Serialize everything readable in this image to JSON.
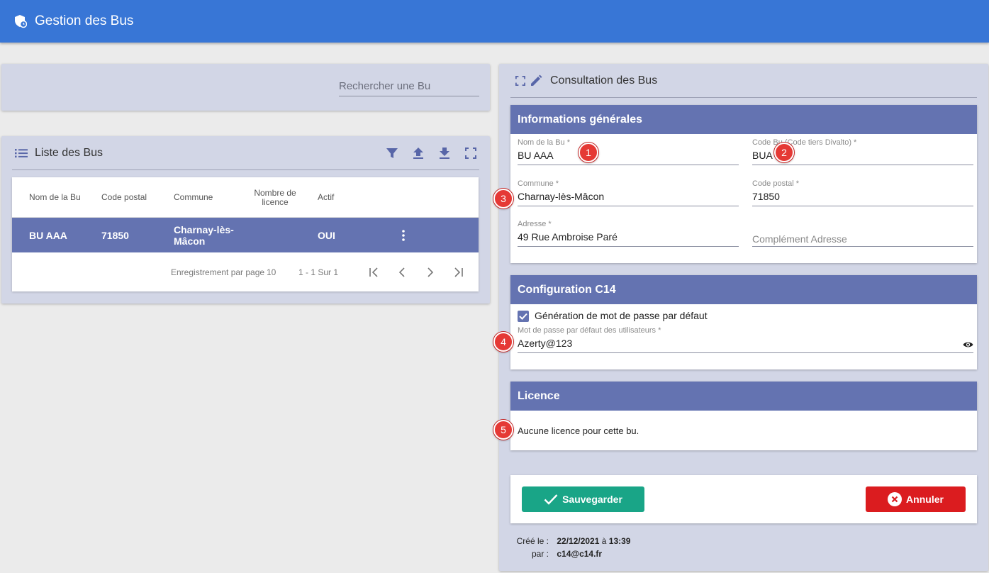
{
  "app": {
    "title": "Gestion des Bus"
  },
  "search": {
    "placeholder": "Rechercher une Bu"
  },
  "list": {
    "title": "Liste des Bus",
    "columns": [
      "Nom de la Bu",
      "Code postal",
      "Commune",
      "Nombre de licence",
      "Actif"
    ],
    "rows": [
      {
        "nom": "BU AAA",
        "code_postal": "71850",
        "commune": "Charnay-lès-Mâcon",
        "nombre_licence": "",
        "actif": "OUI"
      }
    ],
    "footer": {
      "per_page_label": "Enregistrement par page",
      "per_page_value": "10",
      "range": "1 - 1 Sur 1"
    }
  },
  "detail": {
    "title": "Consultation des Bus",
    "general": {
      "title": "Informations générales",
      "nom_label": "Nom de la Bu *",
      "nom_value": "BU AAA",
      "code_label": "Code Bu (Code tiers Divalto) *",
      "code_value": "BUA",
      "commune_label": "Commune *",
      "commune_value": "Charnay-lès-Mâcon",
      "cp_label": "Code postal *",
      "cp_value": "71850",
      "adresse_label": "Adresse *",
      "adresse_value": "49 Rue Ambroise Paré",
      "complement_placeholder": "Complément Adresse"
    },
    "config": {
      "title": "Configuration C14",
      "checkbox_label": "Génération de mot de passe par défaut",
      "password_label": "Mot de passe par défaut des utilisateurs *",
      "password_value": "Azerty@123"
    },
    "licence": {
      "title": "Licence",
      "text": "Aucune licence pour cette bu."
    },
    "actions": {
      "save": "Sauvegarder",
      "cancel": "Annuler"
    },
    "meta": {
      "created_label": "Créé le :",
      "created_date": "22/12/2021",
      "created_sep": "à",
      "created_time": "13:39",
      "by_label": "par :",
      "by_value": "c14@c14.fr"
    }
  },
  "badges": [
    "1",
    "2",
    "3",
    "4",
    "5"
  ],
  "colors": {
    "primary": "#3876d6",
    "section": "#6473b1",
    "save": "#19a587",
    "cancel": "#db1c1f",
    "badge": "#e53935"
  }
}
